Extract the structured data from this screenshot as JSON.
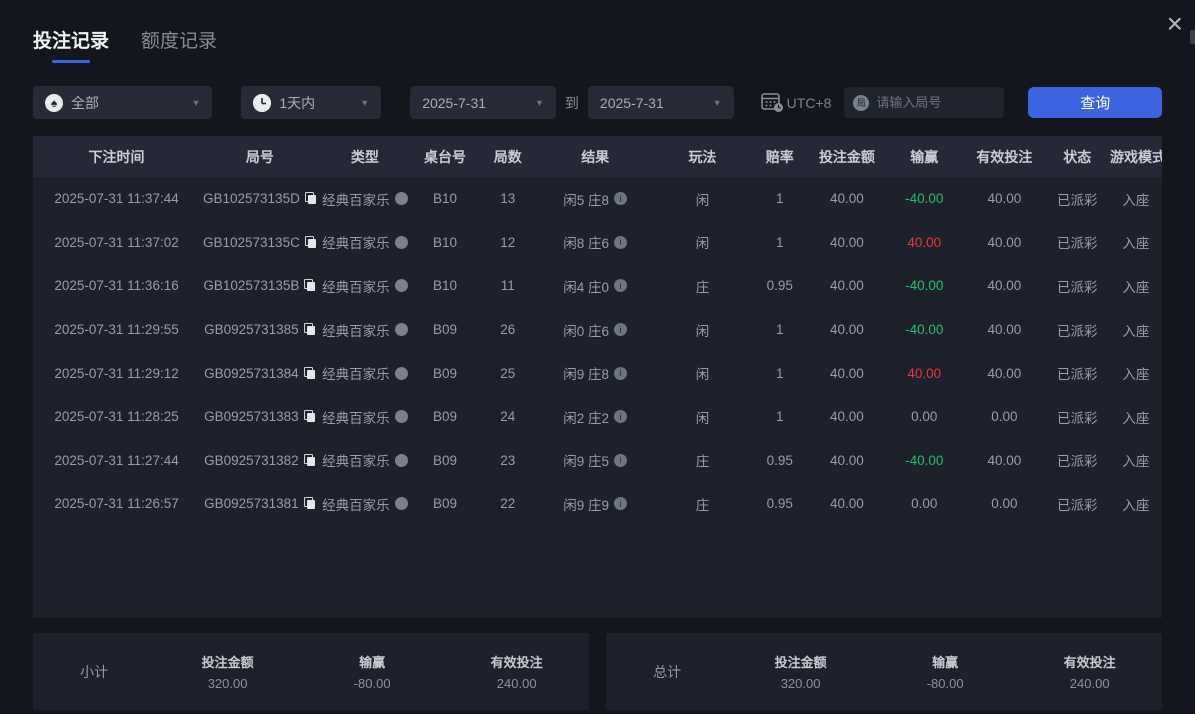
{
  "tabs": [
    {
      "label": "投注记录"
    },
    {
      "label": "额度记录"
    }
  ],
  "close_label": "×",
  "icons": {
    "spade": "♠",
    "info": "i",
    "round_prefix": "局",
    "caret": "▼"
  },
  "filters": {
    "game_type": "全部",
    "time_range": "1天内",
    "date_from": "2025-7-31",
    "to_label": "到",
    "date_to": "2025-7-31",
    "timezone": "UTC+8",
    "round_placeholder": "请输入局号",
    "search_label": "查询"
  },
  "table": {
    "columns": [
      "下注时间",
      "局号",
      "类型",
      "桌台号",
      "局数",
      "结果",
      "玩法",
      "赔率",
      "投注金额",
      "输赢",
      "有效投注",
      "状态",
      "游戏模式"
    ],
    "rows": [
      {
        "time": "2025-07-31 11:37:44",
        "round_id": "GB102573135D",
        "type": "经典百家乐",
        "table_no": "B10",
        "round_no": "13",
        "result": "闲5 庄8",
        "play": "闲",
        "odds": "1",
        "amount": "40.00",
        "win_loss": "-40.00",
        "win_loss_color": "green",
        "valid_bet": "40.00",
        "status": "已派彩",
        "mode": "入座"
      },
      {
        "time": "2025-07-31 11:37:02",
        "round_id": "GB102573135C",
        "type": "经典百家乐",
        "table_no": "B10",
        "round_no": "12",
        "result": "闲8 庄6",
        "play": "闲",
        "odds": "1",
        "amount": "40.00",
        "win_loss": "40.00",
        "win_loss_color": "red",
        "valid_bet": "40.00",
        "status": "已派彩",
        "mode": "入座"
      },
      {
        "time": "2025-07-31 11:36:16",
        "round_id": "GB102573135B",
        "type": "经典百家乐",
        "table_no": "B10",
        "round_no": "11",
        "result": "闲4 庄0",
        "play": "庄",
        "odds": "0.95",
        "amount": "40.00",
        "win_loss": "-40.00",
        "win_loss_color": "green",
        "valid_bet": "40.00",
        "status": "已派彩",
        "mode": "入座"
      },
      {
        "time": "2025-07-31 11:29:55",
        "round_id": "GB0925731385",
        "type": "经典百家乐",
        "table_no": "B09",
        "round_no": "26",
        "result": "闲0 庄6",
        "play": "闲",
        "odds": "1",
        "amount": "40.00",
        "win_loss": "-40.00",
        "win_loss_color": "green",
        "valid_bet": "40.00",
        "status": "已派彩",
        "mode": "入座"
      },
      {
        "time": "2025-07-31 11:29:12",
        "round_id": "GB0925731384",
        "type": "经典百家乐",
        "table_no": "B09",
        "round_no": "25",
        "result": "闲9 庄8",
        "play": "闲",
        "odds": "1",
        "amount": "40.00",
        "win_loss": "40.00",
        "win_loss_color": "red",
        "valid_bet": "40.00",
        "status": "已派彩",
        "mode": "入座"
      },
      {
        "time": "2025-07-31 11:28:25",
        "round_id": "GB0925731383",
        "type": "经典百家乐",
        "table_no": "B09",
        "round_no": "24",
        "result": "闲2 庄2",
        "play": "闲",
        "odds": "1",
        "amount": "40.00",
        "win_loss": "0.00",
        "win_loss_color": "plain",
        "valid_bet": "0.00",
        "status": "已派彩",
        "mode": "入座"
      },
      {
        "time": "2025-07-31 11:27:44",
        "round_id": "GB0925731382",
        "type": "经典百家乐",
        "table_no": "B09",
        "round_no": "23",
        "result": "闲9 庄5",
        "play": "庄",
        "odds": "0.95",
        "amount": "40.00",
        "win_loss": "-40.00",
        "win_loss_color": "green",
        "valid_bet": "40.00",
        "status": "已派彩",
        "mode": "入座"
      },
      {
        "time": "2025-07-31 11:26:57",
        "round_id": "GB0925731381",
        "type": "经典百家乐",
        "table_no": "B09",
        "round_no": "22",
        "result": "闲9 庄9",
        "play": "庄",
        "odds": "0.95",
        "amount": "40.00",
        "win_loss": "0.00",
        "win_loss_color": "plain",
        "valid_bet": "0.00",
        "status": "已派彩",
        "mode": "入座"
      }
    ]
  },
  "summary": {
    "subtotal": {
      "label": "小计",
      "stats": [
        {
          "label": "投注金额",
          "value": "320.00",
          "color": "plain"
        },
        {
          "label": "输赢",
          "value": "-80.00",
          "color": "green"
        },
        {
          "label": "有效投注",
          "value": "240.00",
          "color": "plain"
        }
      ]
    },
    "total": {
      "label": "总计",
      "stats": [
        {
          "label": "投注金额",
          "value": "320.00",
          "color": "plain"
        },
        {
          "label": "输赢",
          "value": "-80.00",
          "color": "green"
        },
        {
          "label": "有效投注",
          "value": "240.00",
          "color": "plain"
        }
      ]
    }
  },
  "colors": {
    "accent": "#3e63e0",
    "green": "#1fc06c",
    "red": "#e03a3a"
  }
}
